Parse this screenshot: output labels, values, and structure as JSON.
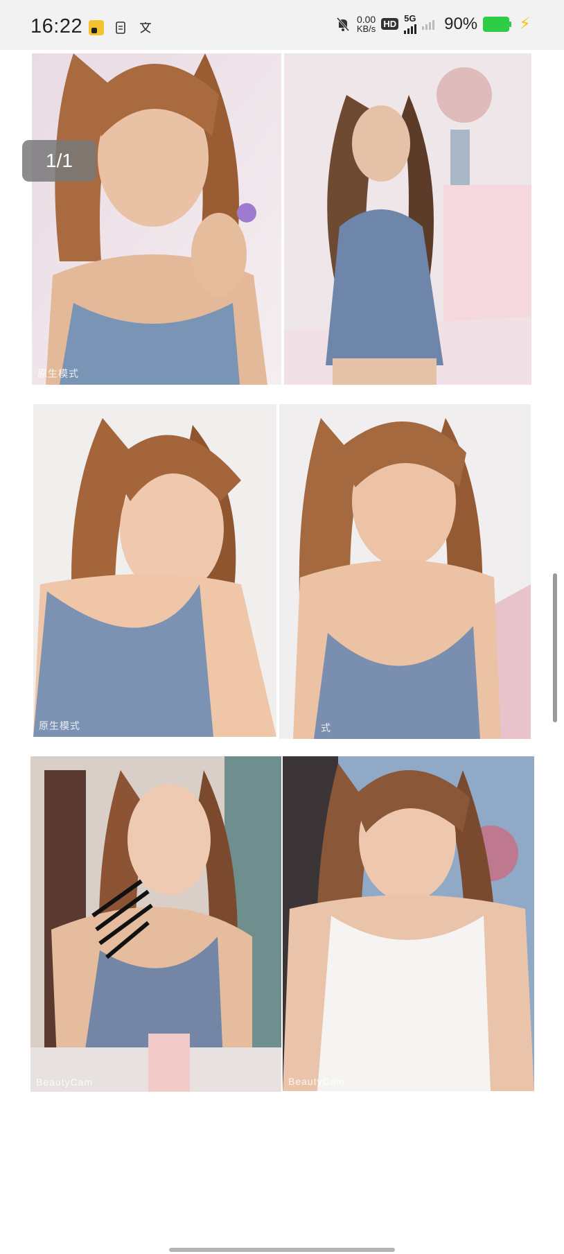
{
  "status_bar": {
    "time": "16:22",
    "net_speed_value": "0.00",
    "net_speed_unit": "KB/s",
    "hd_label": "HD",
    "network_label": "5G",
    "battery_percent": "90%",
    "icons": [
      "app-notification-icon",
      "document-icon",
      "translate-icon",
      "mute-icon",
      "signal-icon",
      "battery-icon",
      "charging-icon"
    ]
  },
  "viewer": {
    "page_indicator": "1/1",
    "photos": [
      {
        "name": "photo-1",
        "watermark": "原生模式"
      },
      {
        "name": "photo-2",
        "watermark": ""
      },
      {
        "name": "photo-3",
        "watermark": "原生模式"
      },
      {
        "name": "photo-4",
        "watermark": "式"
      },
      {
        "name": "photo-5",
        "watermark": "BeautyCam"
      },
      {
        "name": "photo-6",
        "watermark": "BeautyCam"
      }
    ]
  },
  "colors": {
    "status_bg": "#f2f2f2",
    "battery_green": "#2fcc46",
    "bolt_yellow": "#f3c316"
  }
}
